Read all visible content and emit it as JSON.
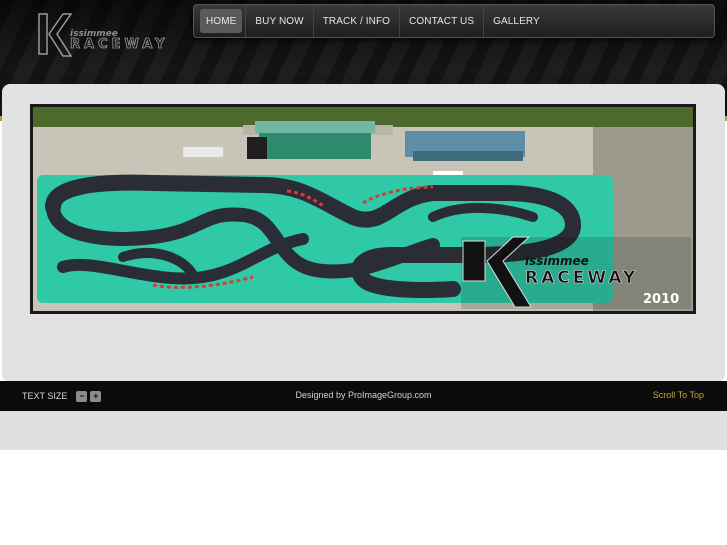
{
  "logo": {
    "text_top": "issimmee",
    "text_main": "RACEWAY",
    "letter": "K"
  },
  "nav": {
    "items": [
      {
        "label": "HOME",
        "active": true
      },
      {
        "label": "BUY NOW",
        "active": false
      },
      {
        "label": "TRACK / INFO",
        "active": false
      },
      {
        "label": "CONTACT US",
        "active": false
      },
      {
        "label": "GALLERY",
        "active": false
      }
    ]
  },
  "banner": {
    "logo_top": "issimmee",
    "logo_main": "RACEWAY",
    "year": "2010"
  },
  "footer": {
    "text_size_label": "TEXT SIZE",
    "decrease_icon": "minus-icon",
    "increase_icon": "plus-icon",
    "designed_by": "Designed by ProImageGroup.com",
    "scroll_top": "Scroll To Top"
  },
  "colors": {
    "accent_gold": "#b79a3a",
    "track_teal": "#2fc9a8",
    "nav_bg": "#2a2a2a"
  }
}
